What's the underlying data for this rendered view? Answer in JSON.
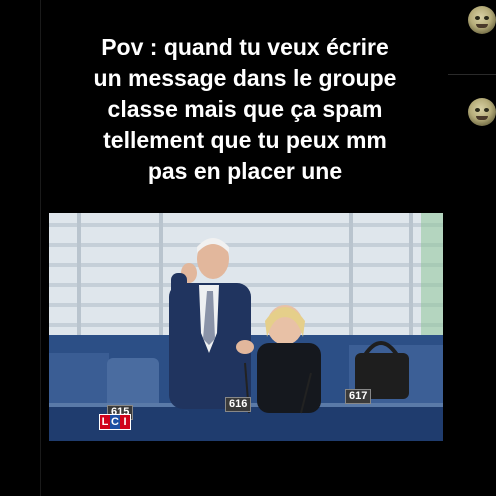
{
  "post": {
    "caption_lines": [
      "Pov : quand tu veux écrire",
      "un message dans le groupe",
      "classe mais que ça spam",
      "tellement que tu peux mm",
      "pas en placer une"
    ]
  },
  "video": {
    "seat_numbers": [
      "615",
      "616",
      "617"
    ],
    "channel_logo_letters": [
      "L",
      "C",
      "I"
    ]
  },
  "colors": {
    "background": "#000000",
    "caption_text": "#ffffff",
    "logo_red": "#d0021b",
    "logo_blue": "#1d4fa3"
  },
  "icons": [
    "avatar-shrek-1",
    "avatar-shrek-2"
  ]
}
